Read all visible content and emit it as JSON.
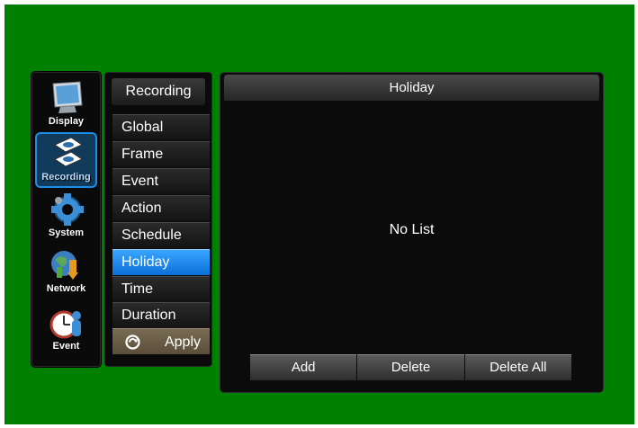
{
  "categories": [
    {
      "label": "Display",
      "icon": "monitor-icon",
      "active": false
    },
    {
      "label": "Recording",
      "icon": "recording-icon",
      "active": true
    },
    {
      "label": "System",
      "icon": "gear-icon",
      "active": false
    },
    {
      "label": "Network",
      "icon": "network-icon",
      "active": false
    },
    {
      "label": "Event",
      "icon": "event-icon",
      "active": false
    }
  ],
  "menu": {
    "title": "Recording",
    "items": [
      {
        "label": "Global"
      },
      {
        "label": "Frame"
      },
      {
        "label": "Event"
      },
      {
        "label": "Action"
      },
      {
        "label": "Schedule"
      },
      {
        "label": "Holiday",
        "active": true
      },
      {
        "label": "Time"
      },
      {
        "label": "Duration"
      }
    ],
    "apply_label": "Apply"
  },
  "panel": {
    "title": "Holiday",
    "empty_message": "No List",
    "buttons": {
      "add": "Add",
      "delete": "Delete",
      "delete_all": "Delete All"
    }
  },
  "colors": {
    "background": "#008000",
    "accent": "#1b8fe8",
    "apply": "#6b5e45"
  }
}
